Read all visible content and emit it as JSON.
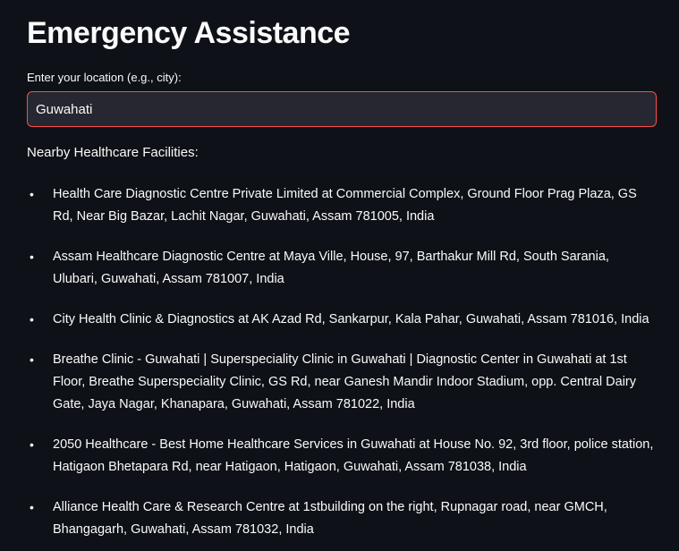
{
  "page": {
    "title": "Emergency Assistance"
  },
  "location_input": {
    "label": "Enter your location (e.g., city):",
    "value": "Guwahati"
  },
  "results": {
    "heading": "Nearby Healthcare Facilities:",
    "bullet_glyph": "•",
    "items": [
      {
        "text": "Health Care Diagnostic Centre Private Limited at Commercial Complex, Ground Floor Prag Plaza, GS Rd, Near Big Bazar, Lachit Nagar, Guwahati, Assam 781005, India"
      },
      {
        "text": "Assam Healthcare Diagnostic Centre at Maya Ville, House, 97, Barthakur Mill Rd, South Sarania, Ulubari, Guwahati, Assam 781007, India"
      },
      {
        "text": "City Health Clinic & Diagnostics at AK Azad Rd, Sankarpur, Kala Pahar, Guwahati, Assam 781016, India"
      },
      {
        "text": "Breathe Clinic - Guwahati | Superspeciality Clinic in Guwahati | Diagnostic Center in Guwahati at 1st Floor, Breathe Superspeciality Clinic, GS Rd, near Ganesh Mandir Indoor Stadium, opp. Central Dairy Gate, Jaya Nagar, Khanapara, Guwahati, Assam 781022, India"
      },
      {
        "text": "2050 Healthcare - Best Home Healthcare Services in Guwahati at House No. 92, 3rd floor, police station, Hatigaon Bhetapara Rd, near Hatigaon, Hatigaon, Guwahati, Assam 781038, India"
      },
      {
        "text": "Alliance Health Care & Research Centre at 1stbuilding on the right, Rupnagar road, near GMCH, Bhangagarh, Guwahati, Assam 781032, India"
      }
    ]
  },
  "colors": {
    "background": "#0e1117",
    "text": "#fafafa",
    "input_background": "#262730",
    "input_focus_border": "#ff4b4b"
  }
}
